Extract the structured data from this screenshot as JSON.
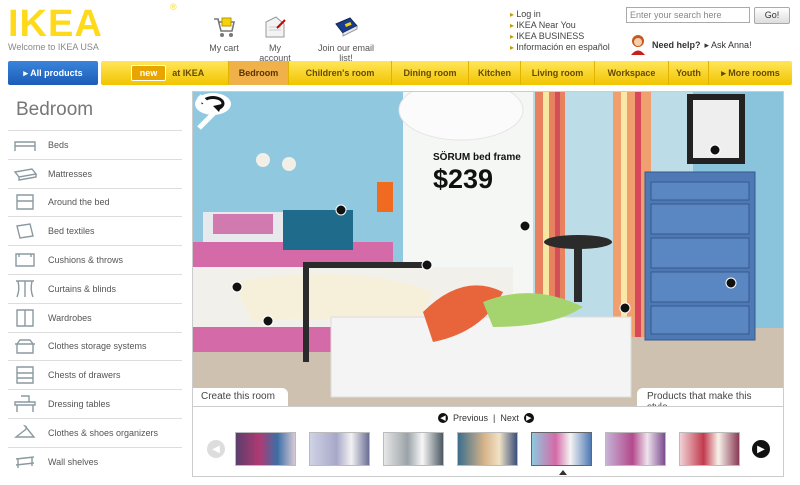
{
  "brand": {
    "logo": "IKEA",
    "reg": "®",
    "welcome": "Welcome to IKEA USA",
    "color": "#ffda1a"
  },
  "header": {
    "cart": "My cart",
    "account": "My account",
    "email": "Join our email list!",
    "links": [
      "Log in",
      "IKEA Near You",
      "IKEA BUSINESS",
      "Información en español"
    ],
    "search_placeholder": "Enter your search here",
    "go": "Go!",
    "need_help": "Need help?",
    "ask_anna": "▸ Ask Anna!"
  },
  "nav": {
    "all_products": "▸ All products",
    "new_badge": "new",
    "items": [
      "at IKEA",
      "Bedroom",
      "Children's room",
      "Dining room",
      "Kitchen",
      "Living room",
      "Workspace",
      "Youth",
      "▸ More rooms"
    ],
    "active": "Bedroom"
  },
  "sidebar": {
    "title": "Bedroom",
    "items": [
      {
        "label": "Beds",
        "icon": "bed-icon"
      },
      {
        "label": "Mattresses",
        "icon": "mattress-icon"
      },
      {
        "label": "Around the bed",
        "icon": "nightstand-icon"
      },
      {
        "label": "Bed textiles",
        "icon": "pillow-icon"
      },
      {
        "label": "Cushions & throws",
        "icon": "cushion-icon"
      },
      {
        "label": "Curtains & blinds",
        "icon": "curtain-icon"
      },
      {
        "label": "Wardrobes",
        "icon": "wardrobe-icon"
      },
      {
        "label": "Clothes storage systems",
        "icon": "storage-icon"
      },
      {
        "label": "Chests of drawers",
        "icon": "drawers-icon"
      },
      {
        "label": "Dressing tables",
        "icon": "dressing-table-icon"
      },
      {
        "label": "Clothes & shoes organizers",
        "icon": "hanger-icon"
      },
      {
        "label": "Wall shelves",
        "icon": "shelf-icon"
      }
    ]
  },
  "hero": {
    "product_name": "SÖRUM bed frame",
    "price": "$239",
    "create_tab": "Create this room",
    "products_tab": "Products that make this style"
  },
  "carousel": {
    "previous": "Previous",
    "next": "Next",
    "separator": "|"
  }
}
